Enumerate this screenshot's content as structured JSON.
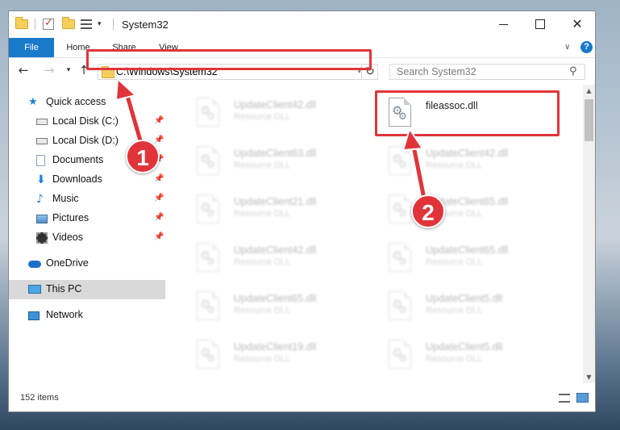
{
  "window": {
    "title": "System32",
    "controls": {
      "minimize": "minimize-icon",
      "maximize": "maximize-icon",
      "close": "close-icon"
    }
  },
  "ribbon": {
    "tabs": [
      {
        "label": "File",
        "active": true
      },
      {
        "label": "Home"
      },
      {
        "label": "Share"
      },
      {
        "label": "View"
      }
    ],
    "help": "?"
  },
  "nav": {
    "address": "C:\\Windows\\System32",
    "search_placeholder": "Search System32"
  },
  "sidebar": {
    "items": [
      {
        "label": "Quick access",
        "icon": "star-icon"
      },
      {
        "label": "Local Disk (C:)",
        "icon": "drive-icon",
        "pinned": true
      },
      {
        "label": "Local Disk (D:)",
        "icon": "drive-icon",
        "pinned": true
      },
      {
        "label": "Documents",
        "icon": "documents-icon",
        "pinned": true
      },
      {
        "label": "Downloads",
        "icon": "download-icon",
        "pinned": true
      },
      {
        "label": "Music",
        "icon": "music-icon",
        "pinned": true
      },
      {
        "label": "Pictures",
        "icon": "pictures-icon",
        "pinned": true
      },
      {
        "label": "Videos",
        "icon": "videos-icon",
        "pinned": true
      },
      {
        "label": "OneDrive",
        "icon": "onedrive-icon"
      },
      {
        "label": "This PC",
        "icon": "this-pc-icon",
        "selected": true
      },
      {
        "label": "Network",
        "icon": "network-icon"
      }
    ]
  },
  "files": {
    "highlighted": {
      "name": "fileassoc.dll"
    },
    "left_column": [
      {
        "name": "UpdateClient42.dll",
        "type": "Resource DLL"
      },
      {
        "name": "UpdateClient63.dll",
        "type": "Resource DLL"
      },
      {
        "name": "UpdateClient21.dll",
        "type": "Resource DLL"
      },
      {
        "name": "UpdateClient42.dll",
        "type": "Resource DLL"
      },
      {
        "name": "UpdateClient65.dll",
        "type": "Resource DLL"
      },
      {
        "name": "UpdateClient19.dll",
        "type": "Resource DLL"
      }
    ],
    "right_column": [
      {
        "name": "UpdateClient42.dll",
        "type": "Resource DLL"
      },
      {
        "name": "UpdateClient65.dll",
        "type": "Resource DLL"
      },
      {
        "name": "UpdateClient65.dll",
        "type": "Resource DLL"
      },
      {
        "name": "UpdateClient5.dll",
        "type": "Resource DLL"
      },
      {
        "name": "UpdateClient5.dll",
        "type": "Resource DLL"
      }
    ]
  },
  "status": {
    "item_count": "152 items"
  },
  "annotations": {
    "markers": [
      "1",
      "2"
    ],
    "color": "#e0343a"
  },
  "colors": {
    "accent": "#1979ca"
  }
}
